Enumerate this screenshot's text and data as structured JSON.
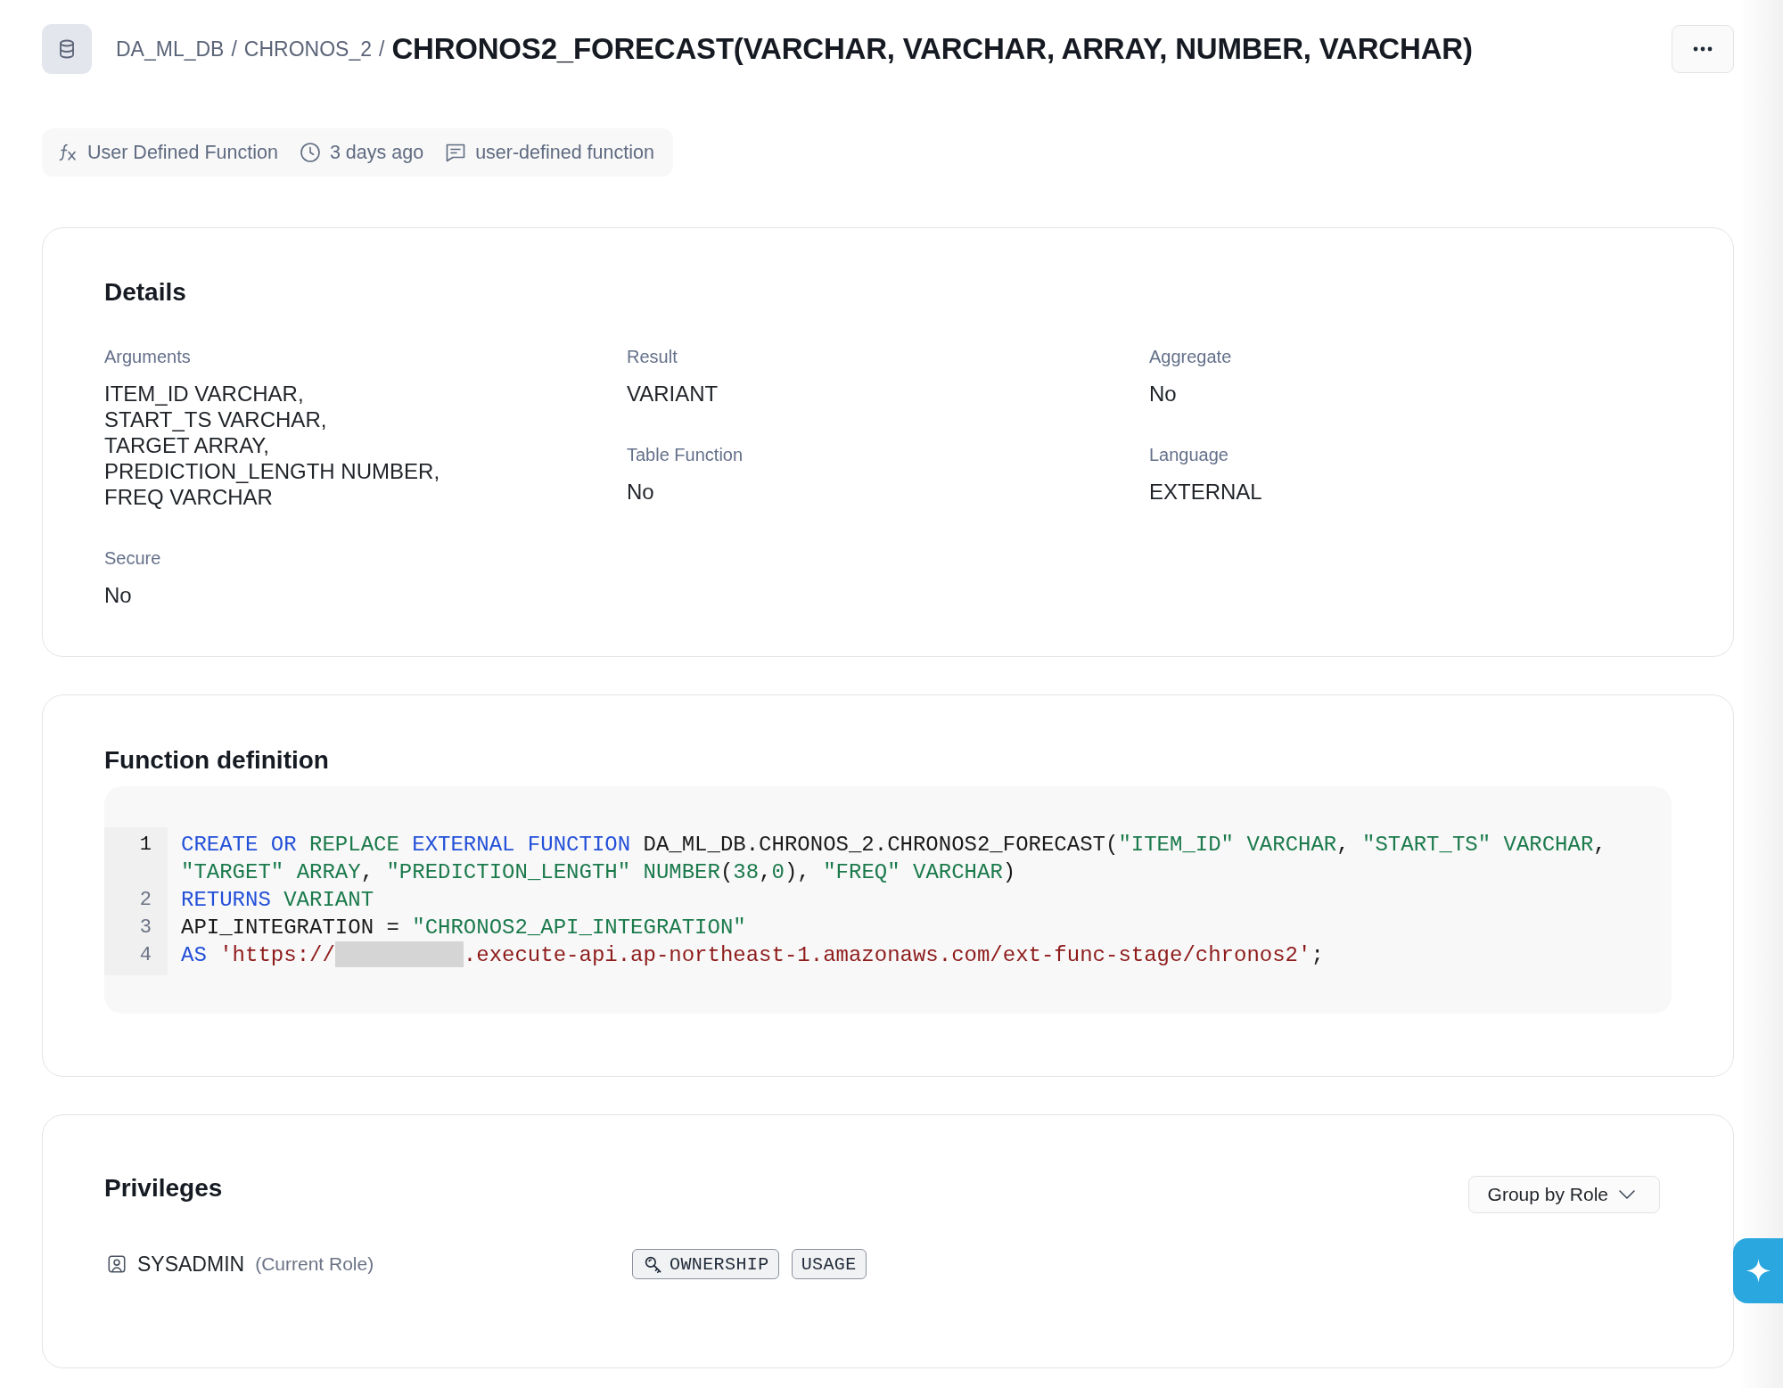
{
  "header": {
    "breadcrumb": [
      {
        "label": "DA_ML_DB",
        "separator": "/"
      },
      {
        "label": "CHRONOS_2",
        "separator": "/"
      }
    ],
    "title": "CHRONOS2_FORECAST(VARCHAR, VARCHAR, ARRAY, NUMBER, VARCHAR)"
  },
  "meta": [
    {
      "kind": "type",
      "text": "User Defined Function"
    },
    {
      "kind": "time",
      "text": "3 days ago"
    },
    {
      "kind": "comment",
      "text": "user-defined function"
    }
  ],
  "details": {
    "title": "Details",
    "columns": [
      [
        {
          "label": "Arguments",
          "value": "ITEM_ID VARCHAR,\nSTART_TS VARCHAR,\nTARGET ARRAY,\nPREDICTION_LENGTH NUMBER,\nFREQ VARCHAR"
        },
        {
          "label": "Secure",
          "value": "No"
        }
      ],
      [
        {
          "label": "Result",
          "value": "VARIANT"
        },
        {
          "label": "Table Function",
          "value": "No"
        }
      ],
      [
        {
          "label": "Aggregate",
          "value": "No"
        },
        {
          "label": "Language",
          "value": "EXTERNAL"
        }
      ]
    ]
  },
  "function_definition": {
    "title": "Function definition",
    "code": {
      "lines": [
        {
          "number": "1",
          "active": true,
          "tokens": [
            {
              "kind": "keyword",
              "text": "CREATE OR "
            },
            {
              "kind": "type",
              "text": "REPLACE "
            },
            {
              "kind": "keyword",
              "text": "EXTERNAL FUNCTION"
            },
            {
              "kind": "text",
              "text": " DA_ML_DB.CHRONOS_2.CHRONOS2_FORECAST("
            },
            {
              "kind": "string",
              "text": "\"ITEM_ID\" "
            },
            {
              "kind": "type",
              "text": "VARCHAR"
            },
            {
              "kind": "text",
              "text": ", "
            },
            {
              "kind": "string",
              "text": "\"START_TS\" "
            },
            {
              "kind": "type",
              "text": "VARCHAR"
            },
            {
              "kind": "text",
              "text": ", "
            },
            {
              "kind": "string",
              "text": "\"TARGET\" "
            },
            {
              "kind": "type",
              "text": "ARRAY"
            },
            {
              "kind": "text",
              "text": ", "
            },
            {
              "kind": "string",
              "text": "\"PREDICTION_LENGTH\" "
            },
            {
              "kind": "type",
              "text": "NUMBER"
            },
            {
              "kind": "text",
              "text": "("
            },
            {
              "kind": "number",
              "text": "38"
            },
            {
              "kind": "text",
              "text": ","
            },
            {
              "kind": "number",
              "text": "0"
            },
            {
              "kind": "text",
              "text": "), "
            },
            {
              "kind": "string",
              "text": "\"FREQ\" "
            },
            {
              "kind": "type",
              "text": "VARCHAR"
            },
            {
              "kind": "text",
              "text": ")"
            }
          ]
        },
        {
          "number": "2",
          "active": false,
          "tokens": [
            {
              "kind": "keyword",
              "text": "RETURNS "
            },
            {
              "kind": "type",
              "text": "VARIANT"
            }
          ]
        },
        {
          "number": "3",
          "active": false,
          "tokens": [
            {
              "kind": "text",
              "text": "API_INTEGRATION = "
            },
            {
              "kind": "string",
              "text": "\"CHRONOS2_API_INTEGRATION\""
            }
          ]
        },
        {
          "number": "4",
          "active": false,
          "tokens": [
            {
              "kind": "keyword",
              "text": "AS "
            },
            {
              "kind": "literal",
              "text": "'https://"
            },
            {
              "kind": "redacted"
            },
            {
              "kind": "literal",
              "text": ".execute-api.ap-northeast-1.amazonaws.com/ext-func-stage/chronos2'"
            },
            {
              "kind": "text",
              "text": ";"
            }
          ]
        }
      ]
    }
  },
  "privileges": {
    "title": "Privileges",
    "group_by": "Group by Role",
    "rows": [
      {
        "role": "SYSADMIN",
        "note": "(Current Role)",
        "grants": [
          {
            "kind": "owner",
            "label": "OWNERSHIP"
          },
          {
            "kind": "grant",
            "label": "USAGE"
          }
        ]
      }
    ]
  }
}
